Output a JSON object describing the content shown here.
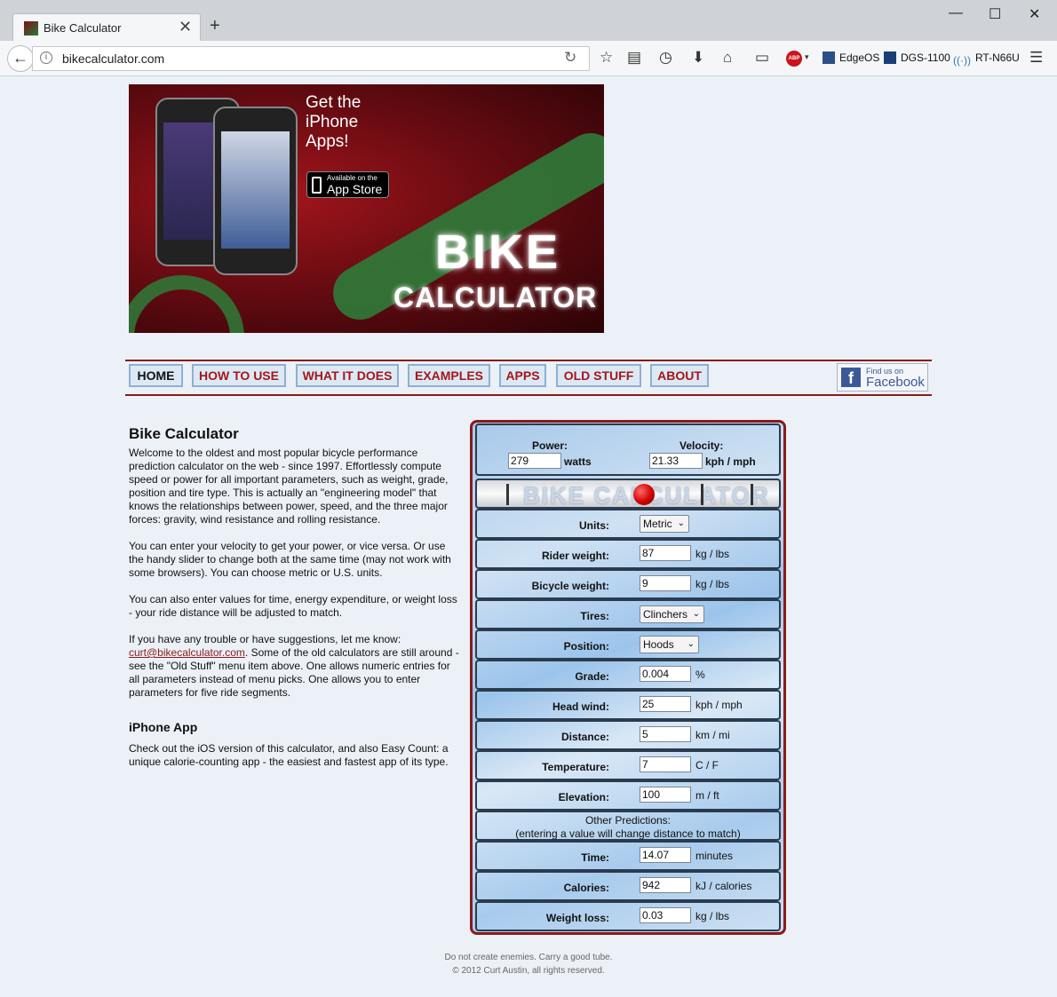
{
  "browser": {
    "tab_title": "Bike Calculator",
    "url": "bikecalculator.com",
    "bookmarks": [
      "EdgeOS",
      "DGS-1100",
      "RT-N66U"
    ],
    "abp_label": "ABP"
  },
  "banner": {
    "headline": [
      "Get the",
      "iPhone",
      "Apps!"
    ],
    "appstore_small": "Available on the",
    "appstore_big": "App Store",
    "logo_bike": "BIKE",
    "logo_calc": "CALCULATOR"
  },
  "nav": {
    "items": [
      "HOME",
      "HOW TO USE",
      "WHAT IT DOES",
      "EXAMPLES",
      "APPS",
      "OLD STUFF",
      "ABOUT"
    ],
    "facebook_small": "Find us on",
    "facebook_big": "Facebook"
  },
  "content": {
    "title": "Bike Calculator",
    "p1": "Welcome to the oldest and most popular bicycle performance prediction calculator on the web - since 1997. Effortlessly compute speed or power for all important parameters, such as weight, grade, position and tire type. This is actually an \"engineering model\" that knows the relationships between power, speed, and the three major forces: gravity, wind resistance and rolling resistance.",
    "p2": "You can enter your velocity to get your power, or vice versa. Or use the handy slider to change both at the same time (may not work with some browsers). You can choose metric or U.S. units.",
    "p3": "You can also enter values for time, energy expenditure, or weight loss - your ride distance will be adjusted to match.",
    "p4_before": "If you have any trouble or have suggestions, let me know: ",
    "email": "curt@bikecalculator.com",
    "p4_after": ". Some of the old calculators are still around - see the \"Old Stuff\" menu item above. One allows numeric entries for all parameters instead of menu picks. One allows you to enter parameters for five ride segments.",
    "iphone_title": "iPhone App",
    "p5": "Check out the iOS version of this calculator, and also Easy Count: a unique calorie-counting app - the easiest and fastest app of its type."
  },
  "calculator": {
    "power_label": "Power:",
    "power_value": "279",
    "power_unit": "watts",
    "velocity_label": "Velocity:",
    "velocity_value": "21.33",
    "velocity_unit": "kph / mph",
    "lcd_text": "BIKE CALCULATOR",
    "units_label": "Units:",
    "units_value": "Metric",
    "rider_weight_label": "Rider weight:",
    "rider_weight_value": "87",
    "rider_weight_unit": "kg / lbs",
    "bicycle_weight_label": "Bicycle weight:",
    "bicycle_weight_value": "9",
    "bicycle_weight_unit": "kg / lbs",
    "tires_label": "Tires:",
    "tires_value": "Clinchers",
    "position_label": "Position:",
    "position_value": "Hoods",
    "grade_label": "Grade:",
    "grade_value": "0.004",
    "grade_unit": "%",
    "headwind_label": "Head wind:",
    "headwind_value": "25",
    "headwind_unit": "kph / mph",
    "distance_label": "Distance:",
    "distance_value": "5",
    "distance_unit": "km / mi",
    "temperature_label": "Temperature:",
    "temperature_value": "7",
    "temperature_unit": "C / F",
    "elevation_label": "Elevation:",
    "elevation_value": "100",
    "elevation_unit": "m / ft",
    "other_line1": "Other Predictions:",
    "other_line2": "(entering a value will change distance to match)",
    "time_label": "Time:",
    "time_value": "14.07",
    "time_unit": "minutes",
    "calories_label": "Calories:",
    "calories_value": "942",
    "calories_unit": "kJ / calories",
    "weightloss_label": "Weight loss:",
    "weightloss_value": "0.03",
    "weightloss_unit": "kg / lbs"
  },
  "footer": {
    "line1": "Do not create enemies. Carry a good tube.",
    "line2": "© 2012 Curt Austin, all rights reserved."
  }
}
